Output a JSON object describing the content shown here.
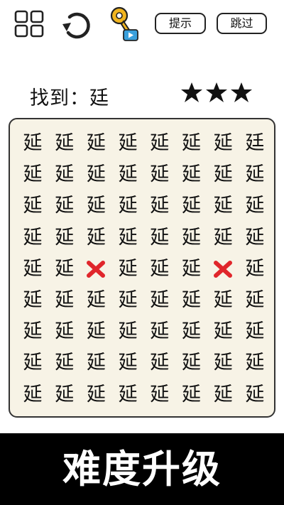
{
  "toolbar": {
    "hint_label": "提示",
    "skip_label": "跳过"
  },
  "task": {
    "label": "找到：",
    "target": "廷",
    "stars_earned": 3,
    "stars_total": 3
  },
  "board": {
    "rows": 9,
    "cols": 8,
    "filler_char": "延",
    "target_char": "廷",
    "target_position": {
      "row": 1,
      "col": 8
    },
    "wrong_marks": [
      {
        "row": 5,
        "col": 3
      },
      {
        "row": 5,
        "col": 7
      }
    ]
  },
  "banner": {
    "text": "难度升级"
  },
  "colors": {
    "background": "#ffffff",
    "board": "#f7f3e6",
    "wrong_mark": "#e0262b",
    "key": "#f2b51f",
    "banner": "#000000"
  }
}
